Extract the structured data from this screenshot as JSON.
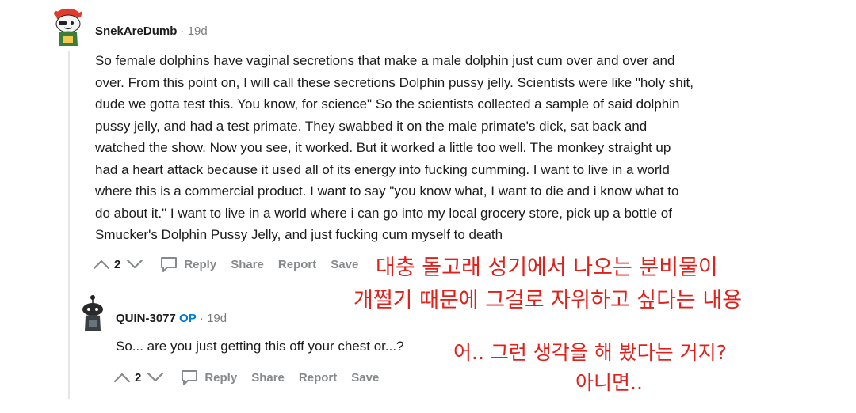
{
  "comments": [
    {
      "avatar_icon": "snoo-red-hat-avatar-icon",
      "username": "SnekAreDumb",
      "separator": " · ",
      "time": "19d",
      "body_lines": [
        "So female dolphins have vaginal secretions that make a male dolphin just cum over and over and",
        "over. From this point on, I will call these secretions Dolphin pussy jelly. Scientists were like \"holy shit,",
        "dude we gotta test this. You know, for science\" So the scientists collected a sample of said dolphin",
        "pussy jelly, and had a test primate. They swabbed it on the male primate's dick, sat back and",
        "watched the show. Now you see, it worked. But it worked a little too well. The monkey straight up",
        "had a heart attack because it used all of its energy into fucking cumming. I want to live in a world",
        "where this is a commercial product. I want to say \"you know what, I want to die and i know what to",
        "do about it.\" I want to live in a world where i can go into my local grocery store, pick up a bottle of",
        "Smucker's Dolphin Pussy Jelly, and just fucking cum myself to death"
      ],
      "votes": "2",
      "actions": {
        "reply": "Reply",
        "share": "Share",
        "report": "Report",
        "save": "Save"
      }
    },
    {
      "avatar_icon": "snoo-dark-avatar-icon",
      "username": "QUIN-3077",
      "op_label": "OP",
      "separator": " · ",
      "time": "19d",
      "body": "So... are you just getting this off your chest or...?",
      "votes": "2",
      "actions": {
        "reply": "Reply",
        "share": "Share",
        "report": "Report",
        "save": "Save"
      }
    }
  ],
  "annotations": {
    "color": "#e0201b",
    "line1": "대충 돌고래 성기에서 나오는 분비물이",
    "line2": "개쩔기 때문에 그걸로 자위하고 싶다는 내용",
    "line3": "어.. 그런 생각을 해 봤다는 거지?",
    "line4": "아니면.."
  }
}
